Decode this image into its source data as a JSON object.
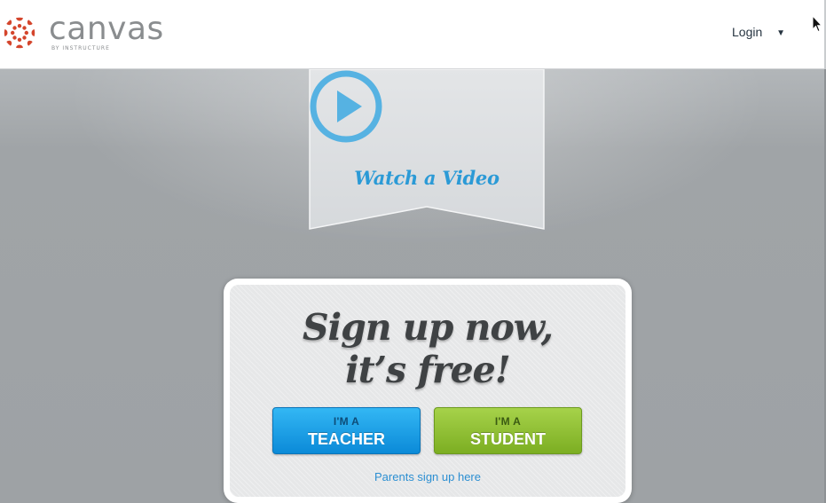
{
  "header": {
    "logo": {
      "wordmark": "canvas",
      "tagline": "BY INSTRUCTURE",
      "icon": "canvas-logo-icon",
      "color": "#d4452c"
    },
    "login": {
      "label": "Login",
      "caret": "▼",
      "caret_icon": "caret-down-icon"
    }
  },
  "banner": {
    "play_icon": "play-circle-icon",
    "label": "Watch a Video",
    "accent_color": "#2b9ad6"
  },
  "signup": {
    "headline_line1": "Sign up now,",
    "headline_line2": "it’s free!",
    "teacher_button": {
      "top": "I'M A",
      "bottom": "TEACHER",
      "color": "#1aa0e8"
    },
    "student_button": {
      "top": "I'M A",
      "bottom": "STUDENT",
      "color": "#8fc136"
    },
    "parents_link": "Parents sign up here"
  },
  "cursor": {
    "icon": "mouse-pointer-icon"
  }
}
